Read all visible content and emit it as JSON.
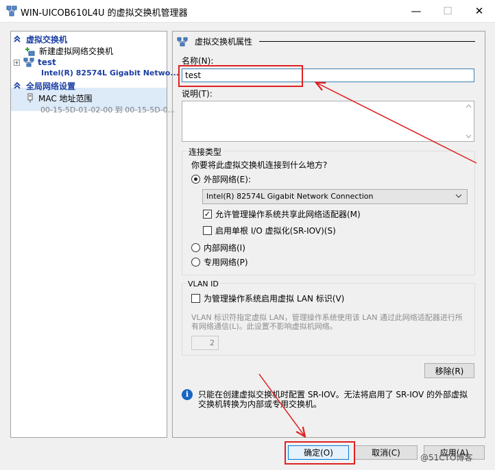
{
  "window": {
    "title": "WIN-UICOB610L4U 的虚拟交换机管理器",
    "minimize": "—",
    "maximize": "☐",
    "close": "✕"
  },
  "tree": {
    "header_switches": "虚拟交换机",
    "new_switch": "新建虚拟网络交换机",
    "switch_name": "test",
    "switch_adapter": "Intel(R) 82574L Gigabit Netwo...",
    "expand_symbol": "+",
    "header_global": "全局网络设置",
    "mac_title": "MAC 地址范围",
    "mac_range": "00-15-5D-01-02-00 到 00-15-5D-0..."
  },
  "props": {
    "section_title": "虚拟交换机属性",
    "name_label": "名称(N):",
    "name_value": "test",
    "notes_label": "说明(T):",
    "conn_group_title": "连接类型",
    "question": "你要将此虚拟交换机连接到什么地方?",
    "external_label": "外部网络(E):",
    "adapter_value": "Intel(R) 82574L Gigabit Network Connection",
    "allow_mgmt_label": "允许管理操作系统共享此网络适配器(M)",
    "sriov_label": "启用单根 I/O 虚拟化(SR-IOV)(S)",
    "internal_label": "内部网络(I)",
    "private_label": "专用网络(P)",
    "vlan_group_title": "VLAN ID",
    "vlan_check_label": "为管理操作系统启用虚拟 LAN 标识(V)",
    "vlan_desc": "VLAN 标识符指定虚拟 LAN，管理操作系统使用该 LAN 通过此网络适配器进行所有网络通信(L)。此设置不影响虚拟机网络。",
    "vlan_id": "2",
    "remove_button": "移除(R)",
    "info_icon": "i",
    "info_text": "只能在创建虚拟交换机时配置 SR-IOV。无法将启用了 SR-IOV 的外部虚拟交换机转换为内部或专用交换机。"
  },
  "state": {
    "external_selected": true,
    "allow_mgmt_checked": true,
    "sriov_checked": false,
    "vlan_checked": false
  },
  "footer": {
    "ok": "确定(O)",
    "cancel": "取消(C)",
    "apply": "应用(A)"
  },
  "watermark": "@51CTO博客",
  "icons": {
    "app": "virtual-switch-manager-icon",
    "collapse": "double-chevron-up-icon",
    "new_switch": "add-network-icon",
    "switch": "network-switch-icon",
    "mac": "mac-address-icon",
    "section": "network-icon",
    "dropdown": "chevron-down-icon",
    "info": "info-icon"
  },
  "colors": {
    "tree_header": "#1c3fa3",
    "selection": "#ddeaf8",
    "annotation": "#e02020",
    "focus_border": "#0078d7"
  }
}
